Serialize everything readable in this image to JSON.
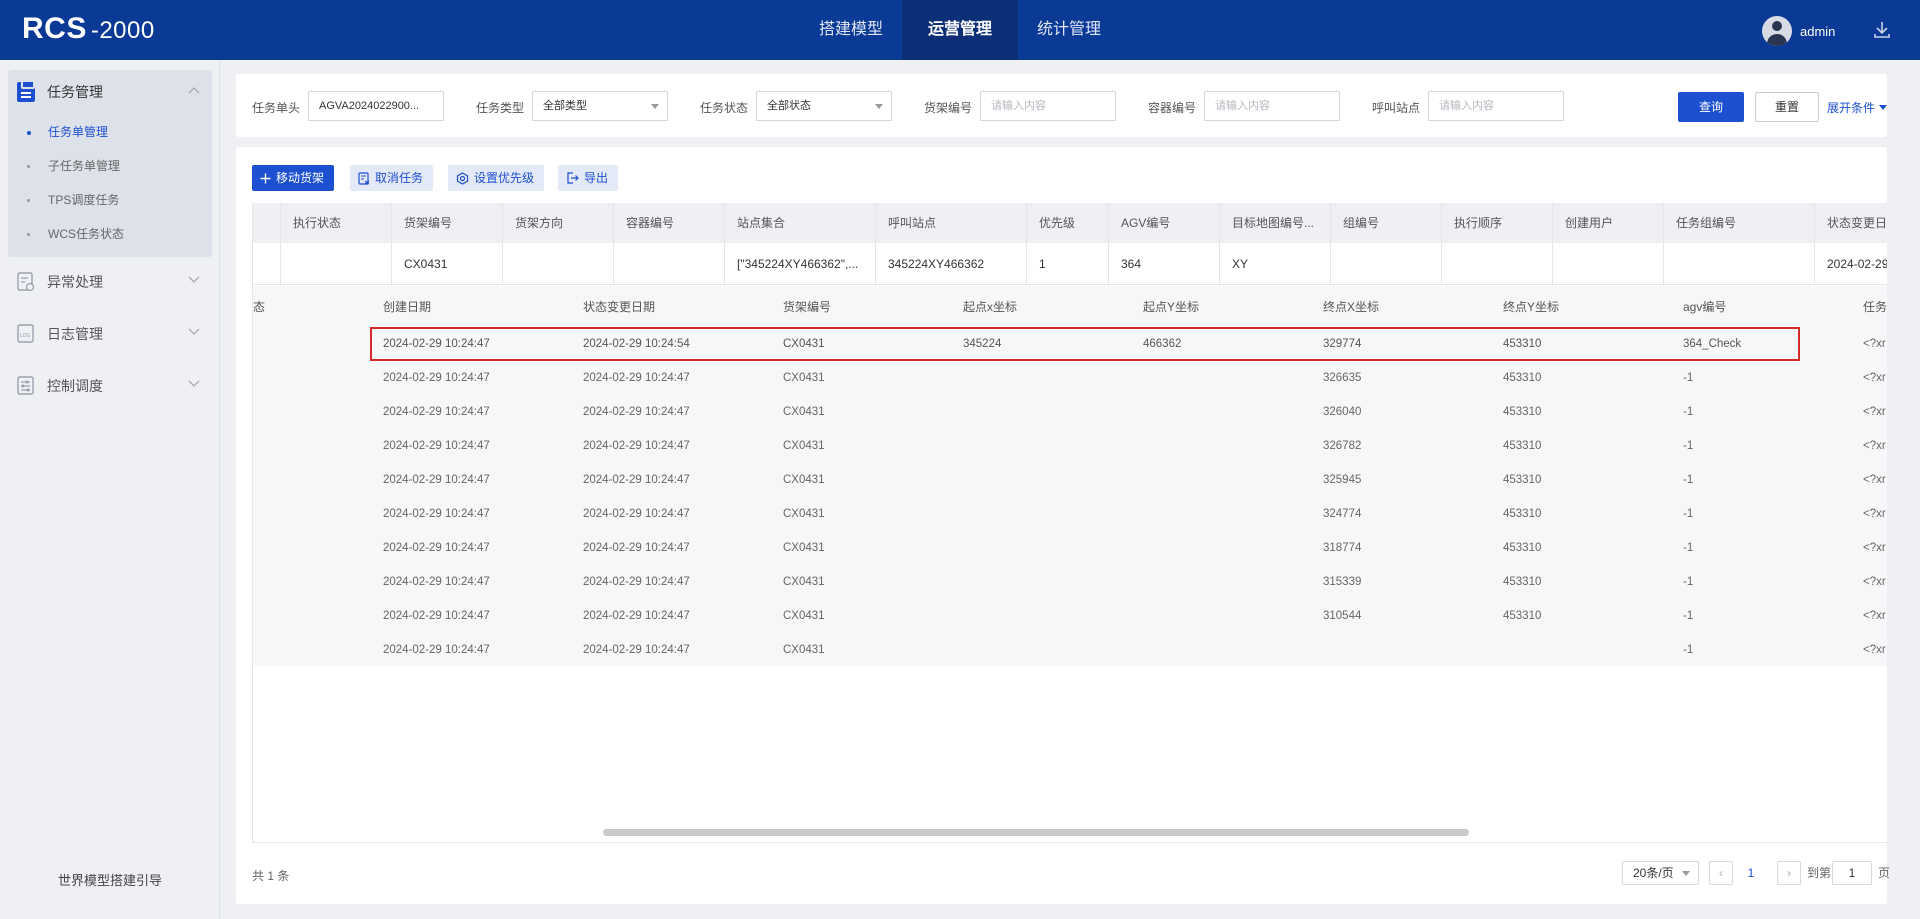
{
  "header": {
    "logo": "RCS",
    "version": "-2000",
    "nav": [
      {
        "label": "搭建模型",
        "active": false
      },
      {
        "label": "运营管理",
        "active": true
      },
      {
        "label": "统计管理",
        "active": false
      }
    ],
    "user": "admin"
  },
  "sidebar": {
    "group": "任务管理",
    "sub_items": [
      "任务单管理",
      "子任务单管理",
      "TPS调度任务",
      "WCS任务状态"
    ],
    "items": [
      "异常处理",
      "日志管理",
      "控制调度"
    ],
    "footer": "世界模型搭建引导"
  },
  "filters": {
    "task_no_label": "任务单头",
    "task_no_value": "AGVA2024022900...",
    "task_type_label": "任务类型",
    "task_type_value": "全部类型",
    "task_status_label": "任务状态",
    "task_status_value": "全部状态",
    "shelf_label": "货架编号",
    "shelf_placeholder": "请输入内容",
    "container_label": "容器编号",
    "container_placeholder": "请输入内容",
    "call_label": "呼叫站点",
    "call_placeholder": "请输入内容",
    "query": "查询",
    "reset": "重置",
    "expand": "展开条件"
  },
  "toolbar": {
    "move_shelf": "移动货架",
    "cancel_task": "取消任务",
    "set_priority": "设置优先级",
    "export": "导出"
  },
  "main_table": {
    "headers": [
      "",
      "执行状态",
      "货架编号",
      "货架方向",
      "容器编号",
      "站点集合",
      "呼叫站点",
      "优先级",
      "AGV编号",
      "目标地图编号...",
      "组编号",
      "执行顺序",
      "创建用户",
      "任务组编号",
      "状态变更日"
    ],
    "row": [
      "",
      "",
      "CX0431",
      "",
      "",
      "[\"345224XY466362\",...",
      "345224XY466362",
      "1",
      "364",
      "XY",
      "",
      "",
      "",
      "",
      "2024-02-29"
    ]
  },
  "sub_table": {
    "headers": [
      "态",
      "创建日期",
      "状态变更日期",
      "货架编号",
      "起点x坐标",
      "起点Y坐标",
      "终点X坐标",
      "终点Y坐标",
      "agv编号",
      "任务"
    ],
    "rows": [
      [
        "2024-02-29 10:24:47",
        "2024-02-29 10:24:54",
        "CX0431",
        "345224",
        "466362",
        "329774",
        "453310",
        "364_Check",
        "<?xr"
      ],
      [
        "2024-02-29 10:24:47",
        "2024-02-29 10:24:47",
        "CX0431",
        "",
        "",
        "326635",
        "453310",
        "-1",
        "<?xr"
      ],
      [
        "2024-02-29 10:24:47",
        "2024-02-29 10:24:47",
        "CX0431",
        "",
        "",
        "326040",
        "453310",
        "-1",
        "<?xr"
      ],
      [
        "2024-02-29 10:24:47",
        "2024-02-29 10:24:47",
        "CX0431",
        "",
        "",
        "326782",
        "453310",
        "-1",
        "<?xr"
      ],
      [
        "2024-02-29 10:24:47",
        "2024-02-29 10:24:47",
        "CX0431",
        "",
        "",
        "325945",
        "453310",
        "-1",
        "<?xr"
      ],
      [
        "2024-02-29 10:24:47",
        "2024-02-29 10:24:47",
        "CX0431",
        "",
        "",
        "324774",
        "453310",
        "-1",
        "<?xr"
      ],
      [
        "2024-02-29 10:24:47",
        "2024-02-29 10:24:47",
        "CX0431",
        "",
        "",
        "318774",
        "453310",
        "-1",
        "<?xr"
      ],
      [
        "2024-02-29 10:24:47",
        "2024-02-29 10:24:47",
        "CX0431",
        "",
        "",
        "315339",
        "453310",
        "-1",
        "<?xr"
      ],
      [
        "2024-02-29 10:24:47",
        "2024-02-29 10:24:47",
        "CX0431",
        "",
        "",
        "310544",
        "453310",
        "-1",
        "<?xr"
      ],
      [
        "2024-02-29 10:24:47",
        "2024-02-29 10:24:47",
        "CX0431",
        "",
        "",
        "",
        "",
        "-1",
        "<?xr"
      ]
    ]
  },
  "pagination": {
    "total": "共 1 条",
    "page_size": "20条/页",
    "current_page": "1",
    "goto_label": "到第",
    "goto_value": "1",
    "page_unit": "页"
  },
  "colors": {
    "header_bg": "#0a3a95",
    "primary": "#1d4fd1",
    "highlight_border": "#d42a2a"
  }
}
